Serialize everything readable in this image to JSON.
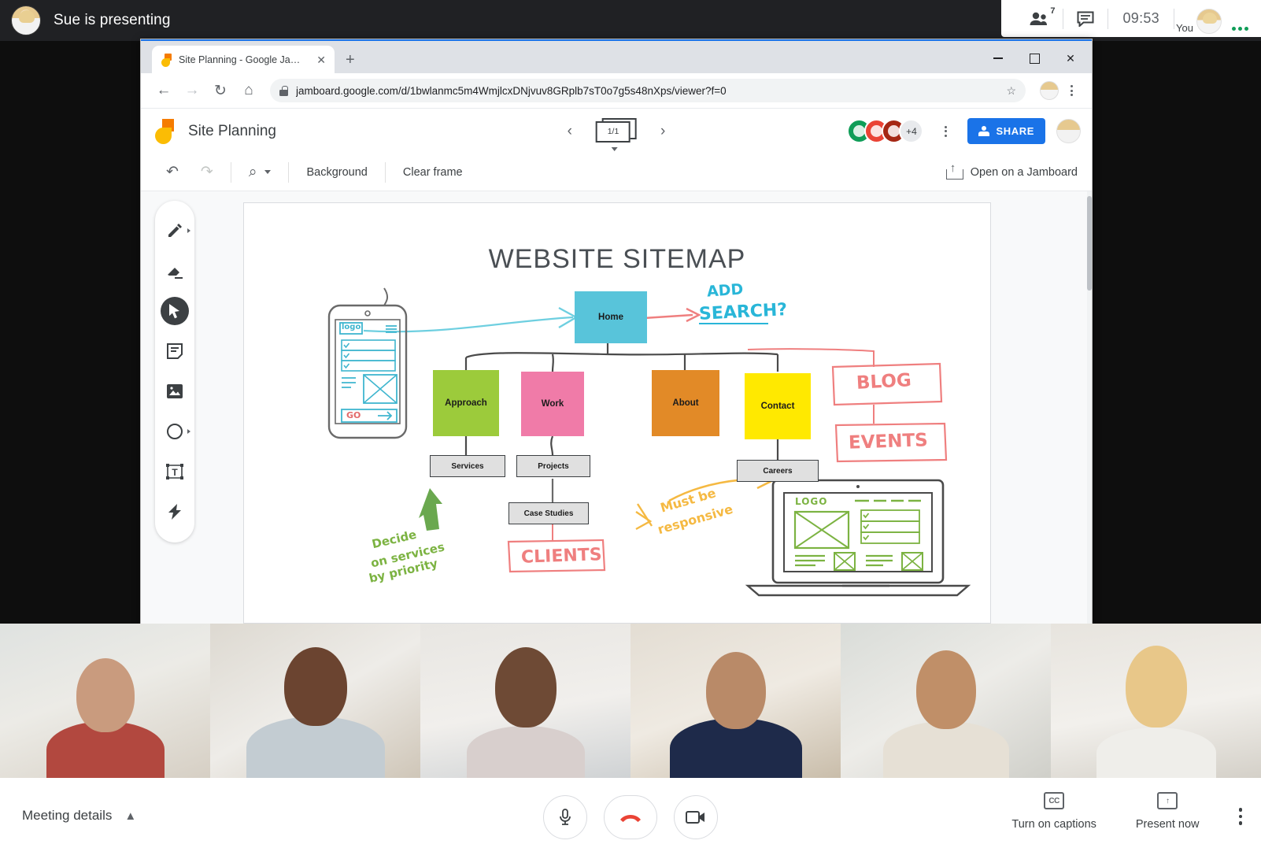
{
  "meet": {
    "presenting_text": "Sue is presenting",
    "participant_count": "7",
    "time": "09:53",
    "you_label": "You",
    "meeting_details": "Meeting details",
    "captions_label": "Turn on captions",
    "captions_icon": "closed-caption-icon",
    "present_label": "Present now",
    "present_icon": "present-up-arrow-icon",
    "controls": {
      "mic": "microphone-icon",
      "hangup": "end-call-icon",
      "camera": "camera-icon"
    },
    "colors": {
      "topbar_bg": "#202124",
      "hangup_red": "#ea4335",
      "presence_green": "#0f9d58"
    }
  },
  "browser": {
    "tab_title": "Site Planning - Google Jamboard",
    "tab_close": "✕",
    "new_tab": "+",
    "window_buttons": {
      "minimize": "—",
      "maximize": "□",
      "close": "✕"
    },
    "nav": {
      "back": "←",
      "forward": "→",
      "reload": "↻",
      "home": "⌂"
    },
    "url": "jamboard.google.com/d/1bwlanmc5m4WmjlcxDNjvuv8GRplb7sT0o7g5s48nXps/viewer?f=0",
    "bookmark_star": "☆"
  },
  "jamboard": {
    "title": "Site Planning",
    "frame_indicator": "1/1",
    "prev_frame": "‹",
    "next_frame": "›",
    "collaborators_overflow": "+4",
    "share_label": "SHARE",
    "open_label": "Open on a Jamboard",
    "toolbar": {
      "undo": "↶",
      "redo": "↷",
      "zoom": "⌕",
      "background": "Background",
      "clear_frame": "Clear frame"
    },
    "tools": [
      {
        "name": "pen-tool",
        "glyph": "✒"
      },
      {
        "name": "eraser-tool",
        "glyph": "▱"
      },
      {
        "name": "select-tool",
        "glyph": "➤"
      },
      {
        "name": "sticky-note-tool",
        "glyph": "☰"
      },
      {
        "name": "image-tool",
        "glyph": "⛰"
      },
      {
        "name": "shape-tool",
        "glyph": "○"
      },
      {
        "name": "text-box-tool",
        "glyph": "T"
      },
      {
        "name": "laser-pointer-tool",
        "glyph": "⚡"
      }
    ]
  },
  "board": {
    "title": "WEBSITE SITEMAP",
    "nodes": [
      {
        "label": "Home",
        "color": "#58c4da"
      },
      {
        "label": "Approach",
        "color": "#9ccb3b"
      },
      {
        "label": "Work",
        "color": "#f07ba8"
      },
      {
        "label": "About",
        "color": "#e28a27"
      },
      {
        "label": "Contact",
        "color": "#ffe900"
      },
      {
        "label": "Services",
        "color": "#e0e0e0"
      },
      {
        "label": "Projects",
        "color": "#e0e0e0"
      },
      {
        "label": "Careers",
        "color": "#e0e0e0"
      },
      {
        "label": "Case Studies",
        "color": "#e0e0e0"
      }
    ],
    "annotations": [
      {
        "text": "ADD",
        "color": "#29b6d8"
      },
      {
        "text": "SEARCH?",
        "color": "#29b6d8"
      },
      {
        "text": "BLOG",
        "color": "#ef7f7f"
      },
      {
        "text": "EVENTS",
        "color": "#ef7f7f"
      },
      {
        "text": "CLIENTS",
        "color": "#ef7f7f"
      },
      {
        "text": "Decide",
        "color": "#7cb342"
      },
      {
        "text": "on services",
        "color": "#7cb342"
      },
      {
        "text": "by priority",
        "color": "#7cb342"
      },
      {
        "text": "Must be",
        "color": "#f5b942"
      },
      {
        "text": "responsive",
        "color": "#f5b942"
      }
    ],
    "mockups": {
      "phone_logo": "logo",
      "phone_cta": "GO",
      "laptop_logo": "LOGO"
    }
  },
  "participants": [
    {
      "name": "participant-1"
    },
    {
      "name": "participant-2"
    },
    {
      "name": "participant-3"
    },
    {
      "name": "participant-4"
    },
    {
      "name": "participant-5"
    },
    {
      "name": "participant-6"
    }
  ]
}
